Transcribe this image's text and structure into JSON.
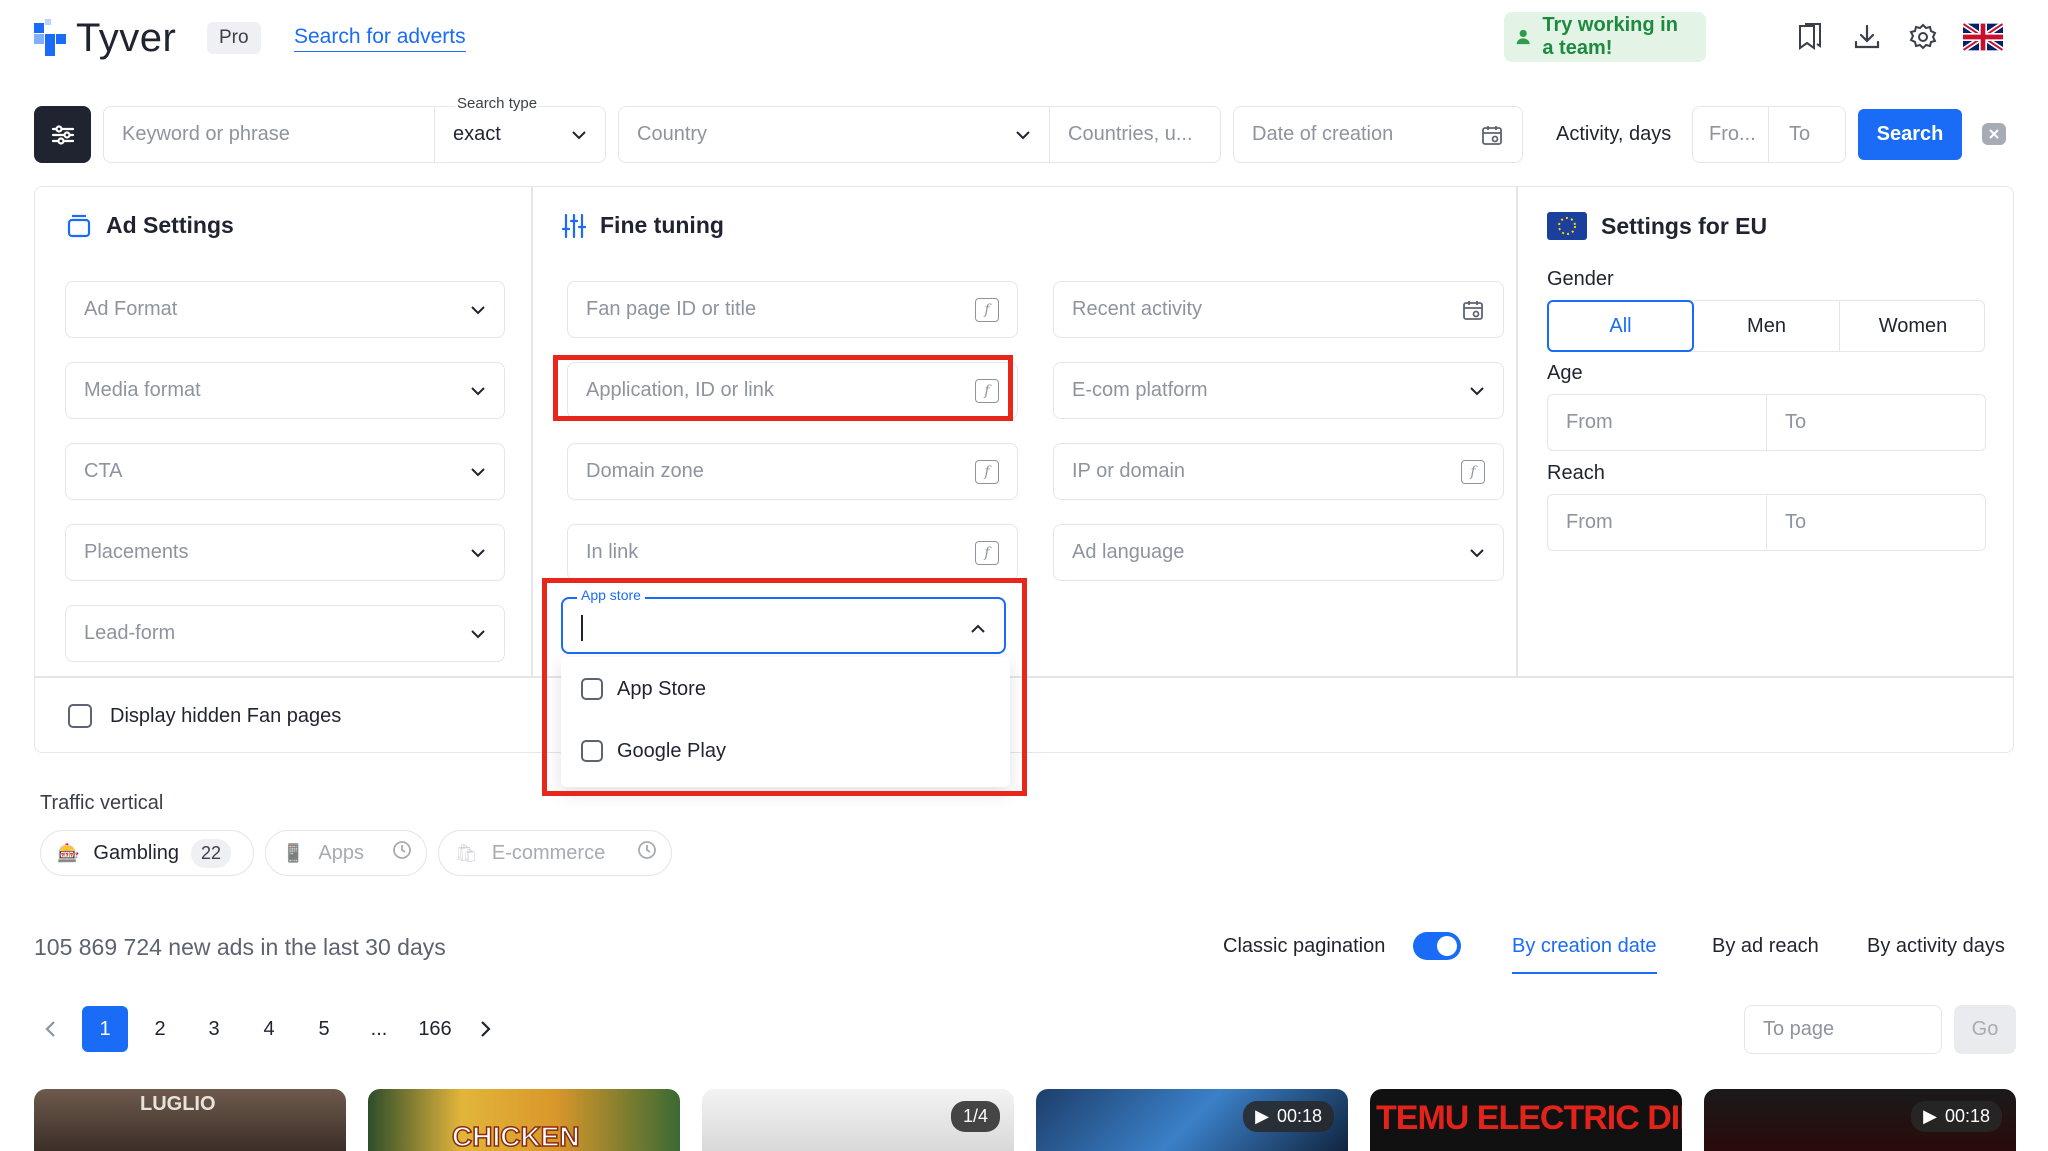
{
  "header": {
    "logo_text": "Tyver",
    "plan_badge": "Pro",
    "search_link": "Search for adverts",
    "team_button": "Try working in a team!",
    "accent": "#1a6cf6"
  },
  "searchbar": {
    "keyword_placeholder": "Keyword or phrase",
    "search_type_label": "Search type",
    "search_type_value": "exact",
    "country_placeholder": "Country",
    "countries_placeholder": "Countries, u...",
    "date_placeholder": "Date of creation",
    "activity_label": "Activity, days",
    "from_placeholder": "Fro...",
    "to_placeholder": "To",
    "search_button": "Search"
  },
  "ad_settings": {
    "title": "Ad Settings",
    "fields": [
      "Ad Format",
      "Media format",
      "CTA",
      "Placements",
      "Lead-form"
    ]
  },
  "fine_tuning": {
    "title": "Fine tuning",
    "left_fields": [
      "Fan page ID or title",
      "Application, ID or link",
      "Domain zone",
      "In link"
    ],
    "right_fields": [
      "Recent activity",
      "E-com platform",
      "IP or domain",
      "Ad language"
    ],
    "app_store_label": "App store",
    "app_store_options": [
      "App Store",
      "Google Play"
    ]
  },
  "eu_settings": {
    "title": "Settings for EU",
    "gender_label": "Gender",
    "gender_options": [
      "All",
      "Men",
      "Women"
    ],
    "age_label": "Age",
    "reach_label": "Reach",
    "from_placeholder": "From",
    "to_placeholder": "To"
  },
  "hidden_fanpages_label": "Display hidden Fan pages",
  "traffic": {
    "title": "Traffic vertical",
    "items": [
      {
        "label": "Gambling",
        "count": "22"
      },
      {
        "label": "Apps"
      },
      {
        "label": "E-commerce"
      }
    ]
  },
  "results": {
    "summary": "105 869 724 new ads in the last 30 days",
    "classic_pagination_label": "Classic pagination",
    "classic_pagination_on": true,
    "sort_tabs": [
      "By creation date",
      "By ad reach",
      "By activity days"
    ],
    "active_sort": "By creation date"
  },
  "pagination": {
    "pages": [
      "1",
      "2",
      "3",
      "4",
      "5",
      "...",
      "166"
    ],
    "current": "1",
    "to_page_placeholder": "To page",
    "go_button": "Go"
  },
  "thumbnails": [
    {
      "overlay_text": "LUGLIO"
    },
    {
      "overlay_text": "CHICKEN"
    },
    {
      "badge": "1/4"
    },
    {
      "badge": "00:18"
    },
    {
      "overlay_text": "TEMU ELECTRIC DIRT BIKE"
    },
    {
      "badge": "00:18"
    }
  ]
}
